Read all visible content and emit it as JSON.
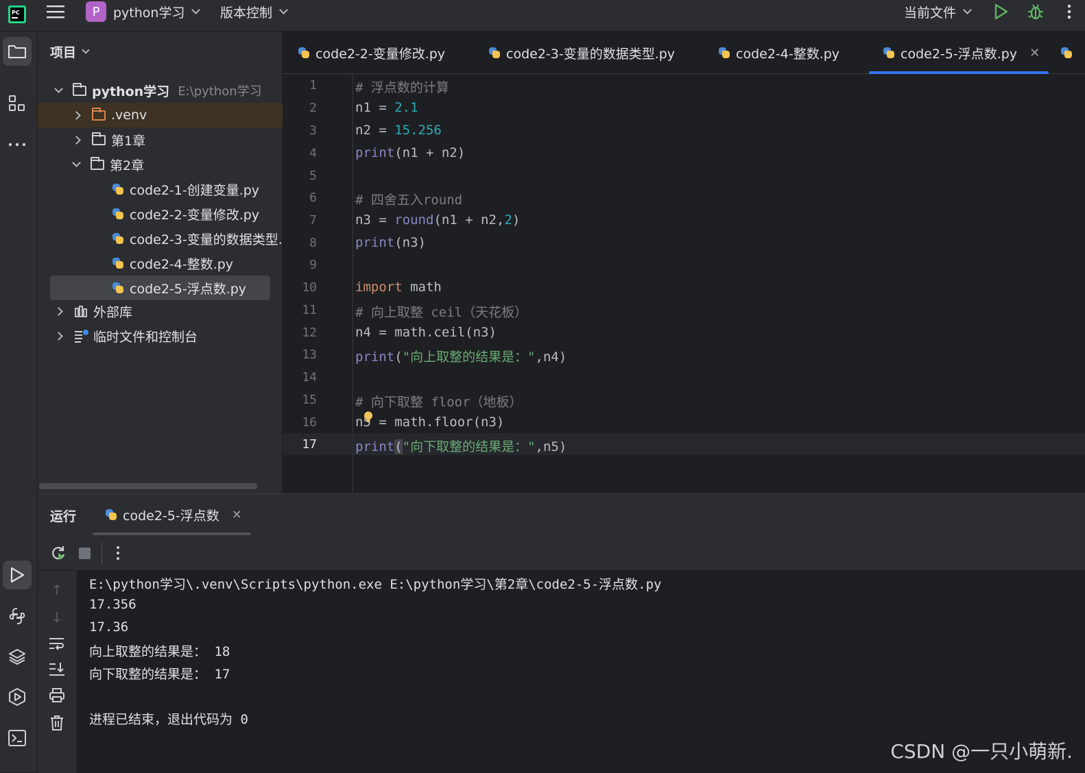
{
  "titlebar": {
    "project_badge": "P",
    "project_name": "python学习",
    "vcs": "版本控制",
    "run_config": "当前文件"
  },
  "project_panel": {
    "title": "项目",
    "root": {
      "name": "python学习",
      "path": "E:\\python学习"
    },
    "items": [
      {
        "label": ".venv"
      },
      {
        "label": "第1章"
      },
      {
        "label": "第2章"
      },
      {
        "label": "code2-1-创建变量.py"
      },
      {
        "label": "code2-2-变量修改.py"
      },
      {
        "label": "code2-3-变量的数据类型.py"
      },
      {
        "label": "code2-4-整数.py"
      },
      {
        "label": "code2-5-浮点数.py"
      },
      {
        "label": "外部库"
      },
      {
        "label": "临时文件和控制台"
      }
    ]
  },
  "tabs": [
    {
      "label": "code2-2-变量修改.py"
    },
    {
      "label": "code2-3-变量的数据类型.py"
    },
    {
      "label": "code2-4-整数.py"
    },
    {
      "label": "code2-5-浮点数.py",
      "active": true
    }
  ],
  "editor": {
    "line_numbers": [
      "1",
      "2",
      "3",
      "4",
      "5",
      "6",
      "7",
      "8",
      "9",
      "10",
      "11",
      "12",
      "13",
      "14",
      "15",
      "16",
      "17"
    ],
    "lines": {
      "l1": "# 浮点数的计算",
      "l2a": "n1 = ",
      "l2b": "2.1",
      "l3a": "n2 = ",
      "l3b": "15.256",
      "l4a": "print",
      "l4b": "(n1 + n2)",
      "l6": "# 四舍五入round",
      "l7a": "n3 = ",
      "l7b": "round",
      "l7c": "(n1 + n2,",
      "l7d": "2",
      "l7e": ")",
      "l8a": "print",
      "l8b": "(n3)",
      "l10a": "import",
      "l10b": " math",
      "l11": "# 向上取整 ceil（天花板）",
      "l12": "n4 = math.ceil(n3)",
      "l13a": "print",
      "l13b": "(",
      "l13c": "\"向上取整的结果是：\"",
      "l13d": ",n4)",
      "l15": "# 向下取整 floor（地板）",
      "l16": "n5 = math.floor(n3)",
      "l17a": "print",
      "l17b": "(",
      "l17c": "\"向下取整的结果是：\"",
      "l17d": ",n5)"
    }
  },
  "run_panel": {
    "title": "运行",
    "tab_label": "code2-5-浮点数",
    "output": [
      "E:\\python学习\\.venv\\Scripts\\python.exe E:\\python学习\\第2章\\code2-5-浮点数.py",
      "17.356",
      "17.36",
      "向上取整的结果是： 18",
      "向下取整的结果是： 17",
      "",
      "进程已结束，退出代码为 0"
    ]
  },
  "watermark": "CSDN @一只小萌新.",
  "colors": {
    "accent": "#3574f0",
    "run_green": "#5fb865",
    "keyword": "#cf8e6d",
    "number": "#2aacb8",
    "string": "#6aab73"
  }
}
